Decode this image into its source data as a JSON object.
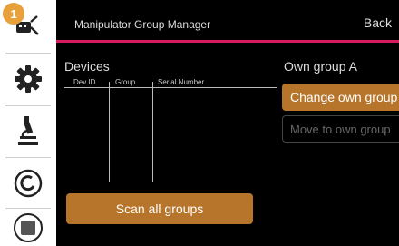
{
  "sidebar": {
    "badge_count": "1",
    "items": [
      {
        "icon": "manipulator-icon"
      },
      {
        "icon": "gear-icon"
      },
      {
        "icon": "microscope-icon"
      },
      {
        "icon": "power-icon"
      },
      {
        "icon": "stop-icon"
      }
    ]
  },
  "header": {
    "title": "Manipulator Group Manager",
    "back_label": "Back"
  },
  "devices": {
    "title": "Devices",
    "columns": [
      "Dev ID",
      "Group",
      "Serial Number"
    ],
    "rows": []
  },
  "scan_button_label": "Scan all groups",
  "own_group": {
    "title": "Own group A",
    "change_label": "Change own group",
    "move_label": "Move to own group"
  },
  "colors": {
    "accent": "#b7752b",
    "badge": "#e8a13a",
    "header_line": "#d81b60"
  }
}
